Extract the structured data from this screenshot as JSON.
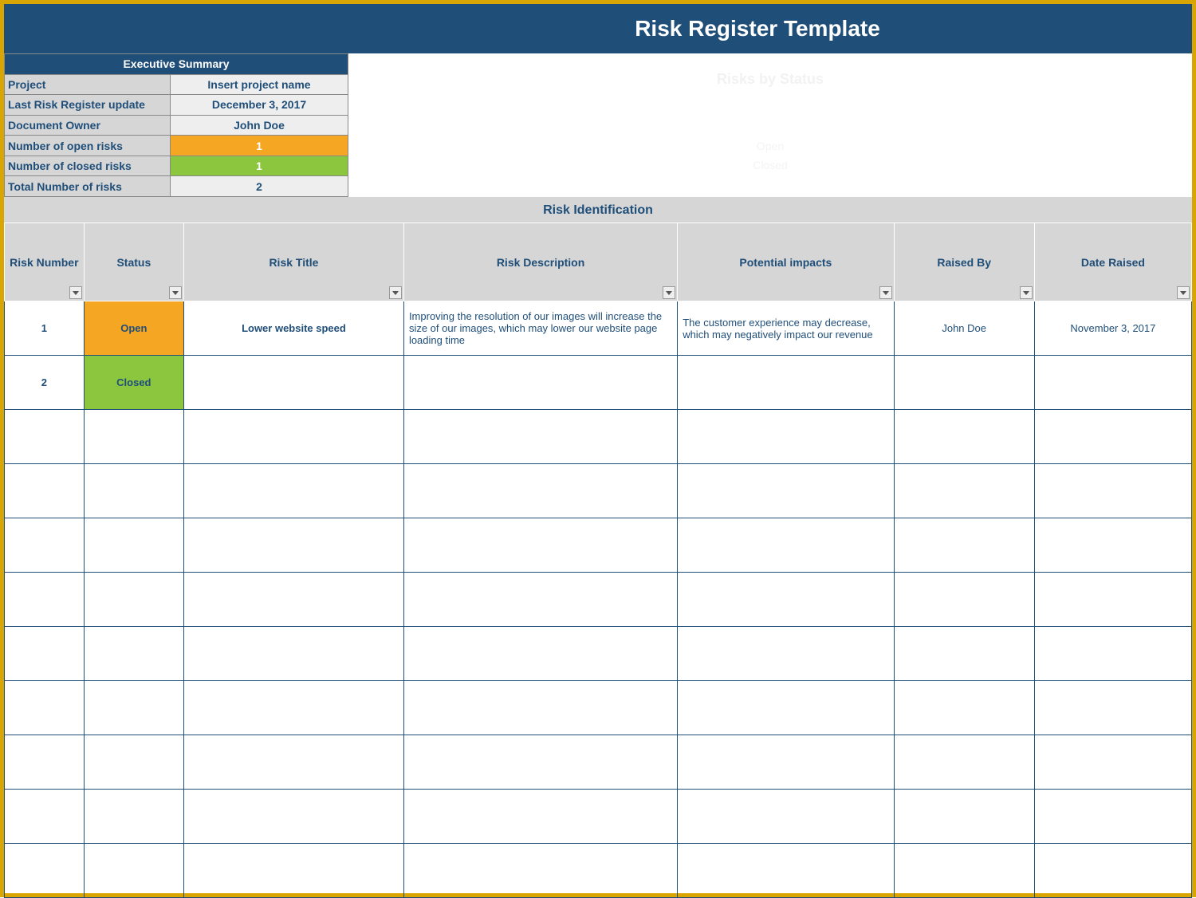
{
  "title": "Risk Register Template",
  "summary": {
    "header": "Executive Summary",
    "rows": {
      "project_label": "Project",
      "project_value": "Insert project name",
      "update_label": "Last Risk Register update",
      "update_value": "December 3, 2017",
      "owner_label": "Document Owner",
      "owner_value": "John Doe",
      "open_label": "Number of open risks",
      "open_value": "1",
      "closed_label": "Number of closed risks",
      "closed_value": "1",
      "total_label": "Total Number of risks",
      "total_value": "2"
    }
  },
  "chart": {
    "title": "Risks by Status",
    "open_label": "Open",
    "closed_label": "Closed"
  },
  "section_header": "Risk Identification",
  "columns": {
    "num": "Risk Number",
    "status": "Status",
    "title": "Risk Title",
    "desc": "Risk Description",
    "impacts": "Potential impacts",
    "raised_by": "Raised By",
    "date": "Date Raised"
  },
  "rows": [
    {
      "num": "1",
      "status": "Open",
      "status_class": "status-open",
      "title": "Lower website speed",
      "desc": "Improving the resolution of our images will increase the size of our images, which may lower our website page loading time",
      "impacts": "The customer experience may decrease, which may negatively impact our revenue",
      "by": "John Doe",
      "date": "November 3, 2017"
    },
    {
      "num": "2",
      "status": "Closed",
      "status_class": "status-closed",
      "title": "",
      "desc": "",
      "impacts": "",
      "by": "",
      "date": ""
    },
    {
      "num": "",
      "status": "",
      "status_class": "",
      "title": "",
      "desc": "",
      "impacts": "",
      "by": "",
      "date": ""
    },
    {
      "num": "",
      "status": "",
      "status_class": "",
      "title": "",
      "desc": "",
      "impacts": "",
      "by": "",
      "date": ""
    },
    {
      "num": "",
      "status": "",
      "status_class": "",
      "title": "",
      "desc": "",
      "impacts": "",
      "by": "",
      "date": ""
    },
    {
      "num": "",
      "status": "",
      "status_class": "",
      "title": "",
      "desc": "",
      "impacts": "",
      "by": "",
      "date": ""
    },
    {
      "num": "",
      "status": "",
      "status_class": "",
      "title": "",
      "desc": "",
      "impacts": "",
      "by": "",
      "date": ""
    },
    {
      "num": "",
      "status": "",
      "status_class": "",
      "title": "",
      "desc": "",
      "impacts": "",
      "by": "",
      "date": ""
    },
    {
      "num": "",
      "status": "",
      "status_class": "",
      "title": "",
      "desc": "",
      "impacts": "",
      "by": "",
      "date": ""
    },
    {
      "num": "",
      "status": "",
      "status_class": "",
      "title": "",
      "desc": "",
      "impacts": "",
      "by": "",
      "date": ""
    },
    {
      "num": "",
      "status": "",
      "status_class": "",
      "title": "",
      "desc": "",
      "impacts": "",
      "by": "",
      "date": ""
    }
  ]
}
